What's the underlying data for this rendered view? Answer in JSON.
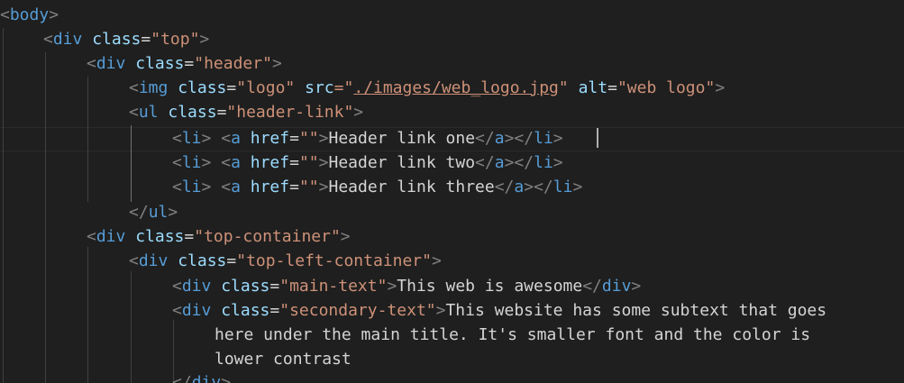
{
  "editor": {
    "colors": {
      "background": "#1f1f1f",
      "tag": "#569cd6",
      "bracket": "#808080",
      "attribute": "#9cdcfe",
      "string": "#ce9178",
      "text": "#d4d4d4"
    },
    "lines": [
      {
        "open": "<",
        "tag": "body",
        "close": ">"
      },
      {
        "open": "<",
        "tag": "div",
        "attr": "class",
        "eq": "=",
        "value": "\"top\"",
        "close": ">"
      },
      {
        "open": "<",
        "tag": "div",
        "attr": "class",
        "eq": "=",
        "value": "\"header\"",
        "close": ">"
      },
      {
        "open": "<",
        "tag": "img",
        "attr": "class",
        "eq": "=",
        "value": "\"logo\"",
        "attr2": "src",
        "eq2": "=\"",
        "link": "./images/web_logo.jpg",
        "q2": "\"",
        "attr3": "alt",
        "eq3": "=",
        "value3": "\"web logo\"",
        "close": ">"
      },
      {
        "open": "<",
        "tag": "ul",
        "attr": "class",
        "eq": "=",
        "value": "\"header-link\"",
        "close": ">"
      },
      {
        "open": "<",
        "tag": "li",
        "close": ">",
        "open2": "<",
        "tag2": "a",
        "attr": "href",
        "eq": "=",
        "value": "\"\"",
        "close2": ">",
        "text": "Header link one",
        "endopen": "</",
        "endtag": "a",
        "endclose": ">",
        "endopen2": "</",
        "endtag2": "li",
        "endclose2": ">"
      },
      {
        "open": "<",
        "tag": "li",
        "close": ">",
        "open2": "<",
        "tag2": "a",
        "attr": "href",
        "eq": "=",
        "value": "\"\"",
        "close2": ">",
        "text": "Header link two",
        "endopen": "</",
        "endtag": "a",
        "endclose": ">",
        "endopen2": "</",
        "endtag2": "li",
        "endclose2": ">"
      },
      {
        "open": "<",
        "tag": "li",
        "close": ">",
        "open2": "<",
        "tag2": "a",
        "attr": "href",
        "eq": "=",
        "value": "\"\"",
        "close2": ">",
        "text": "Header link three",
        "endopen": "</",
        "endtag": "a",
        "endclose": ">",
        "endopen2": "</",
        "endtag2": "li",
        "endclose2": ">"
      },
      {
        "open": "</",
        "tag": "ul",
        "close": ">"
      },
      {
        "open": "<",
        "tag": "div",
        "attr": "class",
        "eq": "=",
        "value": "\"top-container\"",
        "close": ">"
      },
      {
        "open": "<",
        "tag": "div",
        "attr": "class",
        "eq": "=",
        "value": "\"top-left-container\"",
        "close": ">"
      },
      {
        "open": "<",
        "tag": "div",
        "attr": "class",
        "eq": "=",
        "value": "\"main-text\"",
        "close": ">",
        "text": "This web is awesome",
        "endopen": "</",
        "endtag": "div",
        "endclose": ">"
      },
      {
        "open": "<",
        "tag": "div",
        "attr": "class",
        "eq": "=",
        "value": "\"secondary-text\"",
        "close": ">",
        "text": "This website has some subtext that goes"
      },
      {
        "text": "here under the main title. It's smaller font and the color is"
      },
      {
        "text": "lower contrast"
      },
      {
        "open": "</",
        "tag": "div",
        "close": ">"
      }
    ]
  }
}
